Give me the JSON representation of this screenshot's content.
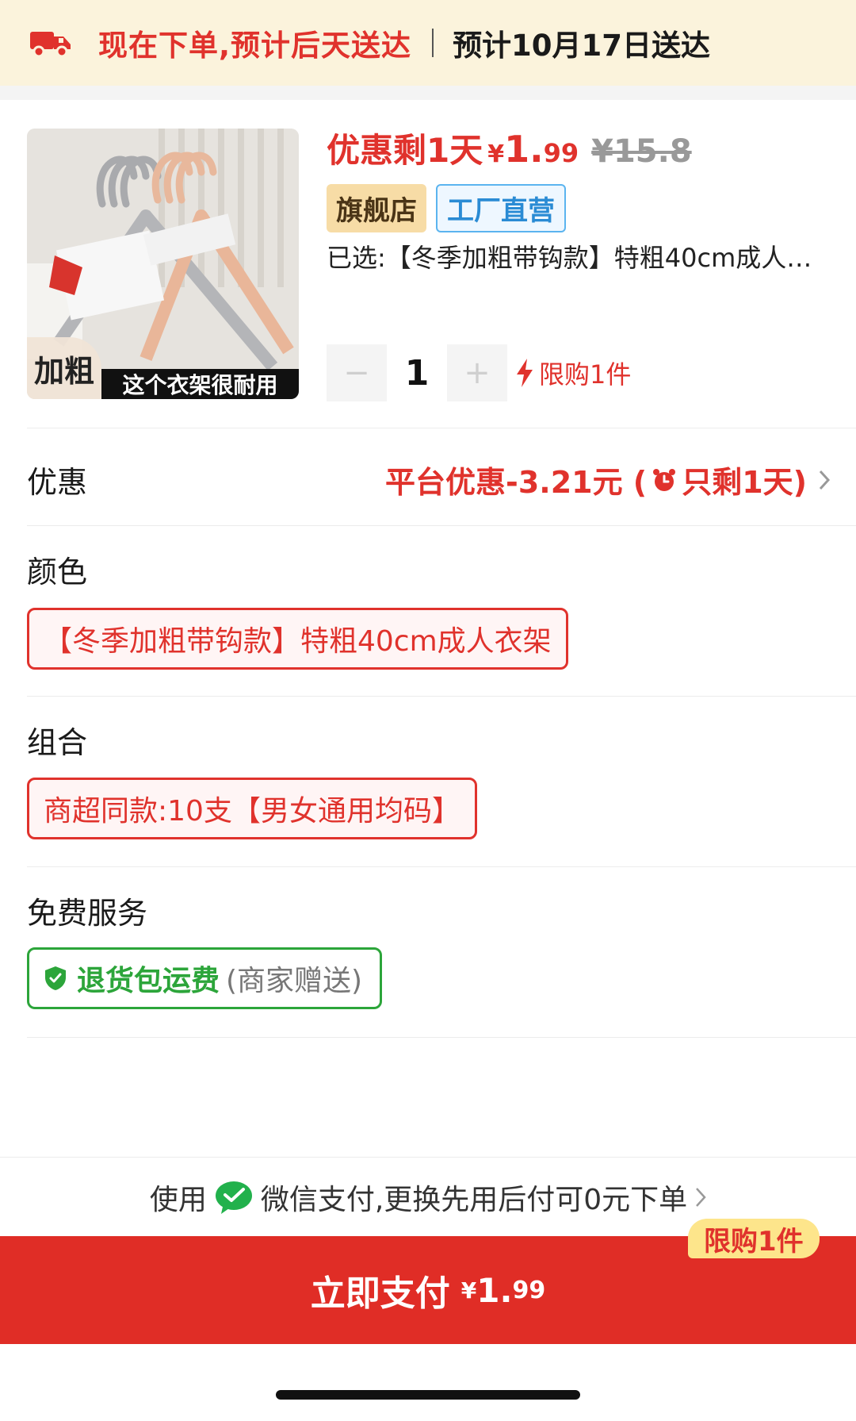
{
  "delivery": {
    "main": "现在下单,预计后天送达",
    "eta": "预计10月17日送达",
    "icon": "truck-icon"
  },
  "product": {
    "image_badge": "加粗",
    "image_slogan": "这个衣架很耐用",
    "promo_text": "优惠剩1天",
    "price_symbol": "¥",
    "price_int": "1.",
    "price_dec": "99",
    "original_price": "¥15.8",
    "tag_flagship": "旗舰店",
    "tag_factory": "工厂直营",
    "selected_spec": "已选:【冬季加粗带钩款】特粗40cm成人衣架 商超同款:10支【男女通用均码】",
    "quantity": "1",
    "qty_minus": "−",
    "qty_plus": "+",
    "purchase_limit": "限购1件"
  },
  "discount": {
    "label": "优惠",
    "value_prefix": "平台优惠-3.21元 (",
    "value_suffix": "只剩1天)"
  },
  "color": {
    "label": "颜色",
    "selected": "【冬季加粗带钩款】特粗40cm成人衣架"
  },
  "combo": {
    "label": "组合",
    "selected": "商超同款:10支【男女通用均码】"
  },
  "service": {
    "label": "免费服务",
    "name": "退货包运费",
    "note": "(商家赠送)"
  },
  "payment": {
    "hint_prefix": "使用",
    "hint_suffix": "微信支付,更换先用后付可0元下单",
    "button_label": "立即支付",
    "price_symbol": "¥",
    "price_int": "1.",
    "price_dec": "99",
    "limit_badge": "限购1件"
  },
  "colors": {
    "accent_red": "#e0322c",
    "service_green": "#2ca53a",
    "banner_bg": "#fbf3dc",
    "badge_yellow": "#fde58b"
  }
}
